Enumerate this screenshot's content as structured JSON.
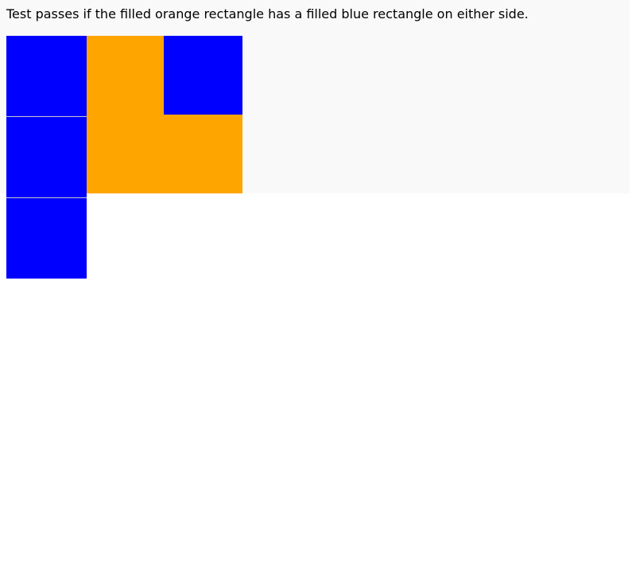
{
  "instruction": {
    "text": "Test passes if the filled orange rectangle has a filled blue rectangle on either side."
  },
  "colors": {
    "blue": "#0000ff",
    "orange": "#ffa500",
    "band": "#f9f9f9"
  }
}
